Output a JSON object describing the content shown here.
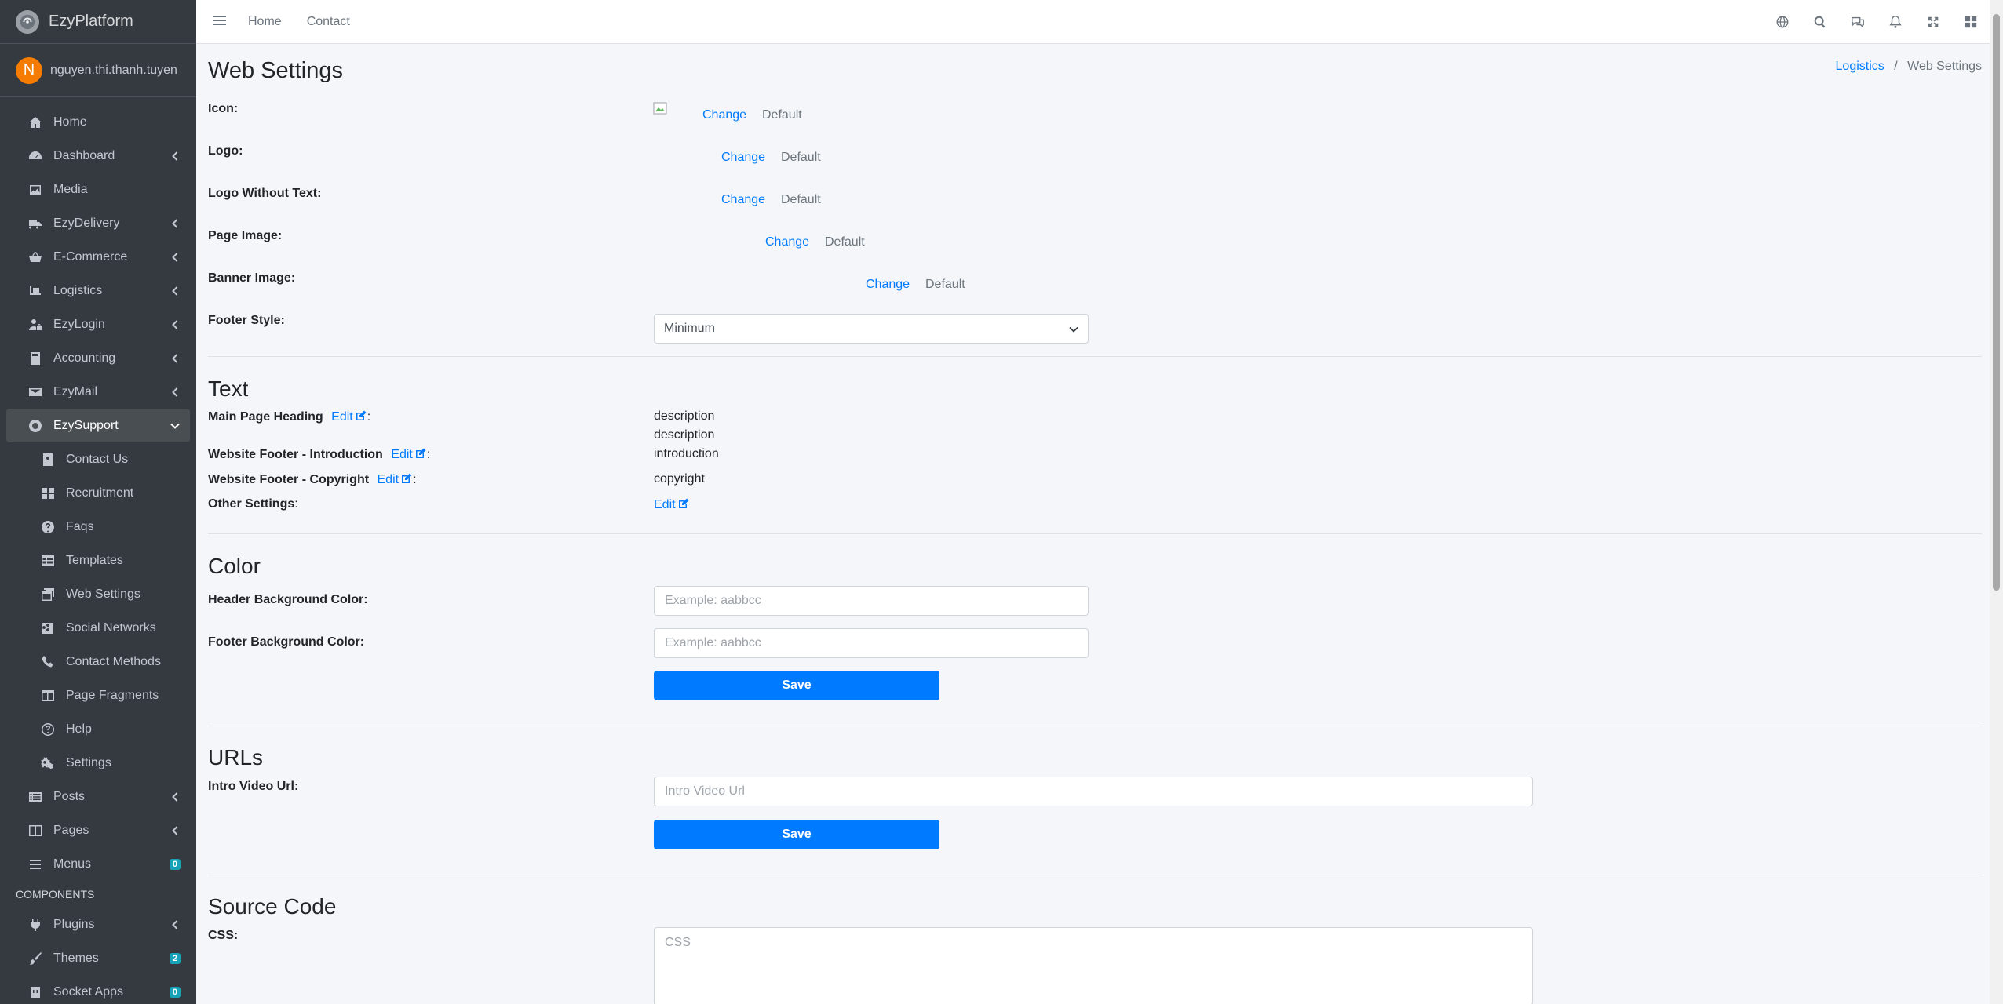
{
  "brand": {
    "name": "EzyPlatform"
  },
  "user": {
    "initial": "N",
    "name": "nguyen.thi.thanh.tuyen"
  },
  "sidebar": {
    "items": [
      {
        "label": "Home",
        "icon": "home-icon",
        "arrow": false
      },
      {
        "label": "Dashboard",
        "icon": "dashboard-icon",
        "arrow": true
      },
      {
        "label": "Media",
        "icon": "image-icon",
        "arrow": false
      },
      {
        "label": "EzyDelivery",
        "icon": "truck-icon",
        "arrow": true
      },
      {
        "label": "E-Commerce",
        "icon": "basket-icon",
        "arrow": true
      },
      {
        "label": "Logistics",
        "icon": "pallet-icon",
        "arrow": true
      },
      {
        "label": "EzyLogin",
        "icon": "user-lock-icon",
        "arrow": true
      },
      {
        "label": "Accounting",
        "icon": "calculator-icon",
        "arrow": true
      },
      {
        "label": "EzyMail",
        "icon": "envelope-icon",
        "arrow": true
      },
      {
        "label": "EzySupport",
        "icon": "lifebuoy-icon",
        "arrow": "down",
        "active": true
      }
    ],
    "sub_items": [
      {
        "label": "Contact Us",
        "icon": "contact-icon"
      },
      {
        "label": "Recruitment",
        "icon": "grid-icon"
      },
      {
        "label": "Faqs",
        "icon": "question-icon"
      },
      {
        "label": "Templates",
        "icon": "table-icon"
      },
      {
        "label": "Web Settings",
        "icon": "window-icon"
      },
      {
        "label": "Social Networks",
        "icon": "share-icon"
      },
      {
        "label": "Contact Methods",
        "icon": "phone-icon"
      },
      {
        "label": "Page Fragments",
        "icon": "columns-icon"
      },
      {
        "label": "Help",
        "icon": "help-circle-icon"
      },
      {
        "label": "Settings",
        "icon": "cogs-icon"
      }
    ],
    "after_items": [
      {
        "label": "Posts",
        "icon": "list-icon",
        "arrow": true
      },
      {
        "label": "Pages",
        "icon": "book-icon",
        "arrow": true
      },
      {
        "label": "Menus",
        "icon": "bars-icon",
        "badge": "0"
      }
    ],
    "components_header": "COMPONENTS",
    "component_items": [
      {
        "label": "Plugins",
        "icon": "plug-icon",
        "arrow": true
      },
      {
        "label": "Themes",
        "icon": "brush-icon",
        "badge": "2"
      },
      {
        "label": "Socket Apps",
        "icon": "socket-icon",
        "badge": "0"
      }
    ]
  },
  "topbar": {
    "links": [
      "Home",
      "Contact"
    ],
    "icons": [
      "globe-icon",
      "search-icon",
      "comments-icon",
      "bell-icon",
      "expand-icon",
      "apps-icon"
    ]
  },
  "page": {
    "title": "Web Settings",
    "breadcrumb": {
      "parent": "Logistics",
      "separator": "/",
      "current": "Web Settings"
    }
  },
  "images": {
    "icon": {
      "label": "Icon:",
      "change": "Change",
      "default": "Default"
    },
    "logo": {
      "label": "Logo:",
      "change": "Change",
      "default": "Default"
    },
    "logo_without_text": {
      "label": "Logo Without Text:",
      "change": "Change",
      "default": "Default"
    },
    "page_image": {
      "label": "Page Image:",
      "change": "Change",
      "default": "Default"
    },
    "banner_image": {
      "label": "Banner Image:",
      "change": "Change",
      "default": "Default"
    },
    "footer_style": {
      "label": "Footer Style:",
      "value": "Minimum"
    }
  },
  "text_section": {
    "title": "Text",
    "edit": "Edit",
    "main_heading": {
      "label": "Main Page Heading",
      "values": [
        "description",
        "description"
      ]
    },
    "footer_intro": {
      "label": "Website Footer - Introduction",
      "value": "introduction"
    },
    "footer_copyright": {
      "label": "Website Footer - Copyright",
      "value": "copyright"
    },
    "other": {
      "label": "Other Settings"
    },
    "colon": ":"
  },
  "color_section": {
    "title": "Color",
    "header_bg": {
      "label": "Header Background Color:",
      "placeholder": "Example: aabbcc"
    },
    "footer_bg": {
      "label": "Footer Background Color:",
      "placeholder": "Example: aabbcc"
    },
    "save": "Save"
  },
  "urls_section": {
    "title": "URLs",
    "intro_video": {
      "label": "Intro Video Url:",
      "placeholder": "Intro Video Url"
    },
    "save": "Save"
  },
  "source_section": {
    "title": "Source Code",
    "css": {
      "label": "CSS:",
      "placeholder": "CSS"
    }
  },
  "colors": {
    "sidebar_bg": "#343a40",
    "accent": "#007bff",
    "badge": "#17a2b8",
    "avatar": "#f57c00"
  }
}
